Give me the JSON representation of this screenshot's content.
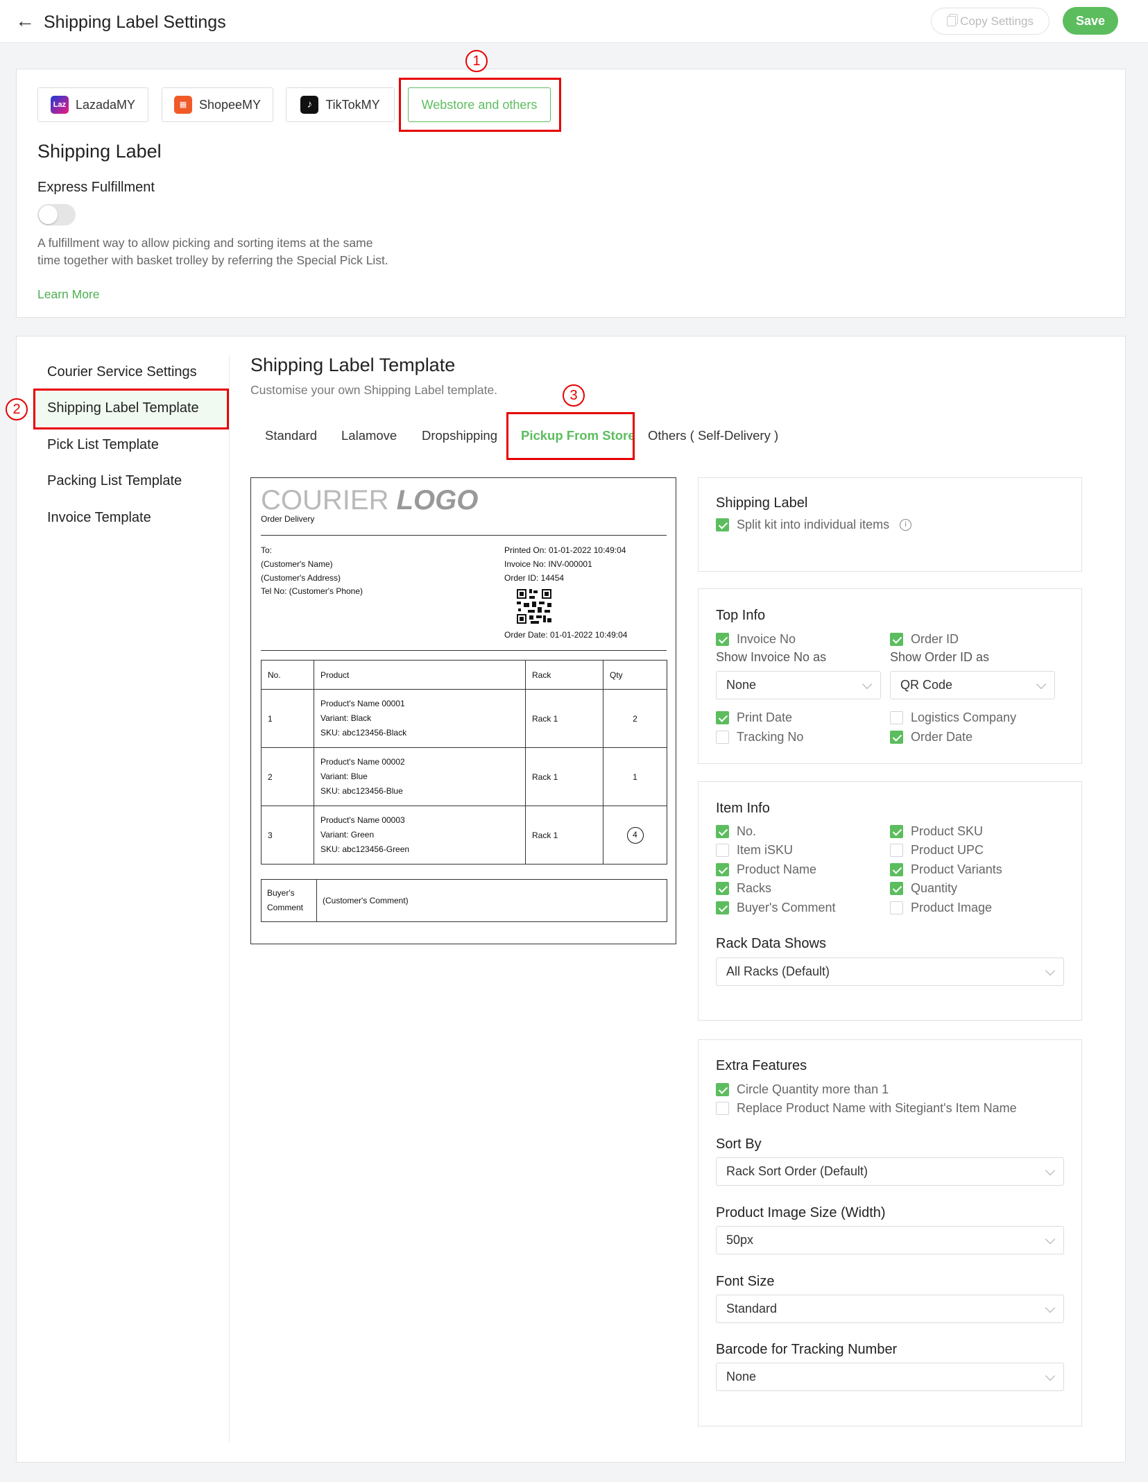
{
  "header": {
    "title": "Shipping Label Settings",
    "copy_label": "Copy Settings",
    "save_label": "Save"
  },
  "marketplace_tabs": [
    {
      "label": "LazadaMY",
      "icon": "lazada-icon"
    },
    {
      "label": "ShopeeMY",
      "icon": "shopee-icon"
    },
    {
      "label": "TikTokMY",
      "icon": "tiktok-icon"
    },
    {
      "label": "Webstore and others"
    }
  ],
  "markers": [
    "1",
    "2",
    "3",
    "4"
  ],
  "shipping_label": {
    "heading": "Shipping Label",
    "express_label": "Express Fulfillment",
    "express_enabled": false,
    "description": "A fulfillment way to allow picking and sorting items at the same time together with basket trolley by referring the Special Pick List.",
    "learn_more": "Learn More"
  },
  "sidebar": [
    "Courier Service Settings",
    "Shipping Label Template",
    "Pick List Template",
    "Packing List Template",
    "Invoice Template"
  ],
  "template": {
    "title": "Shipping Label Template",
    "subtitle": "Customise your own Shipping Label template.",
    "tabs": [
      "Standard",
      "Lalamove",
      "Dropshipping",
      "Pickup From Store",
      "Others ( Self-Delivery )"
    ]
  },
  "preview": {
    "logo_a": "COURIER",
    "logo_b": "LOGO",
    "order_type": "Order Delivery",
    "to_lines": [
      "To:",
      "(Customer's Name)",
      "(Customer's Address)",
      "Tel No: (Customer's Phone)"
    ],
    "right_lines": [
      "Printed On: 01-01-2022 10:49:04",
      "Invoice No: INV-000001",
      "Order ID: 14454"
    ],
    "order_date": "Order Date: 01-01-2022 10:49:04",
    "columns": [
      "No.",
      "Product",
      "Rack",
      "Qty"
    ],
    "rows": [
      {
        "no": "1",
        "name": "Product's Name 00001",
        "variant": "Variant: Black",
        "sku": "SKU: abc123456-Black",
        "rack": "Rack 1",
        "qty": "2"
      },
      {
        "no": "2",
        "name": "Product's Name 00002",
        "variant": "Variant: Blue",
        "sku": "SKU: abc123456-Blue",
        "rack": "Rack 1",
        "qty": "1"
      },
      {
        "no": "3",
        "name": "Product's Name 00003",
        "variant": "Variant: Green",
        "sku": "SKU: abc123456-Green",
        "rack": "Rack 1",
        "qty": "4"
      }
    ],
    "comment_label_1": "Buyer's",
    "comment_label_2": "Comment",
    "comment_value": "(Customer's Comment)"
  },
  "settings": {
    "shipping_label": {
      "title": "Shipping Label",
      "split_kit": {
        "label": "Split kit into individual items",
        "checked": true
      }
    },
    "top_info": {
      "title": "Top Info",
      "invoice_no": {
        "label": "Invoice No",
        "checked": true
      },
      "order_id": {
        "label": "Order ID",
        "checked": true
      },
      "show_invoice_label": "Show Invoice No as",
      "show_invoice_value": "None",
      "show_order_label": "Show Order ID as",
      "show_order_value": "QR Code",
      "print_date": {
        "label": "Print Date",
        "checked": true
      },
      "logistics_company": {
        "label": "Logistics Company",
        "checked": false
      },
      "tracking_no": {
        "label": "Tracking No",
        "checked": false
      },
      "order_date": {
        "label": "Order Date",
        "checked": true
      }
    },
    "item_info": {
      "title": "Item Info",
      "left": [
        {
          "label": "No.",
          "checked": true
        },
        {
          "label": "Item iSKU",
          "checked": false
        },
        {
          "label": "Product Name",
          "checked": true
        },
        {
          "label": "Racks",
          "checked": true
        },
        {
          "label": "Buyer's Comment",
          "checked": true
        }
      ],
      "right": [
        {
          "label": "Product SKU",
          "checked": true
        },
        {
          "label": "Product UPC",
          "checked": false
        },
        {
          "label": "Product Variants",
          "checked": true
        },
        {
          "label": "Quantity",
          "checked": true
        },
        {
          "label": "Product Image",
          "checked": false
        }
      ],
      "rack_label": "Rack Data Shows",
      "rack_value": "All Racks (Default)"
    },
    "extra": {
      "title": "Extra Features",
      "circle_qty": {
        "label": "Circle Quantity more than 1",
        "checked": true
      },
      "replace_name": {
        "label": "Replace Product Name with Sitegiant's Item Name",
        "checked": false
      },
      "sort_label": "Sort By",
      "sort_value": "Rack Sort Order (Default)",
      "image_label": "Product Image Size (Width)",
      "image_value": "50px",
      "font_label": "Font Size",
      "font_value": "Standard",
      "barcode_label": "Barcode for Tracking Number",
      "barcode_value": "None"
    }
  }
}
